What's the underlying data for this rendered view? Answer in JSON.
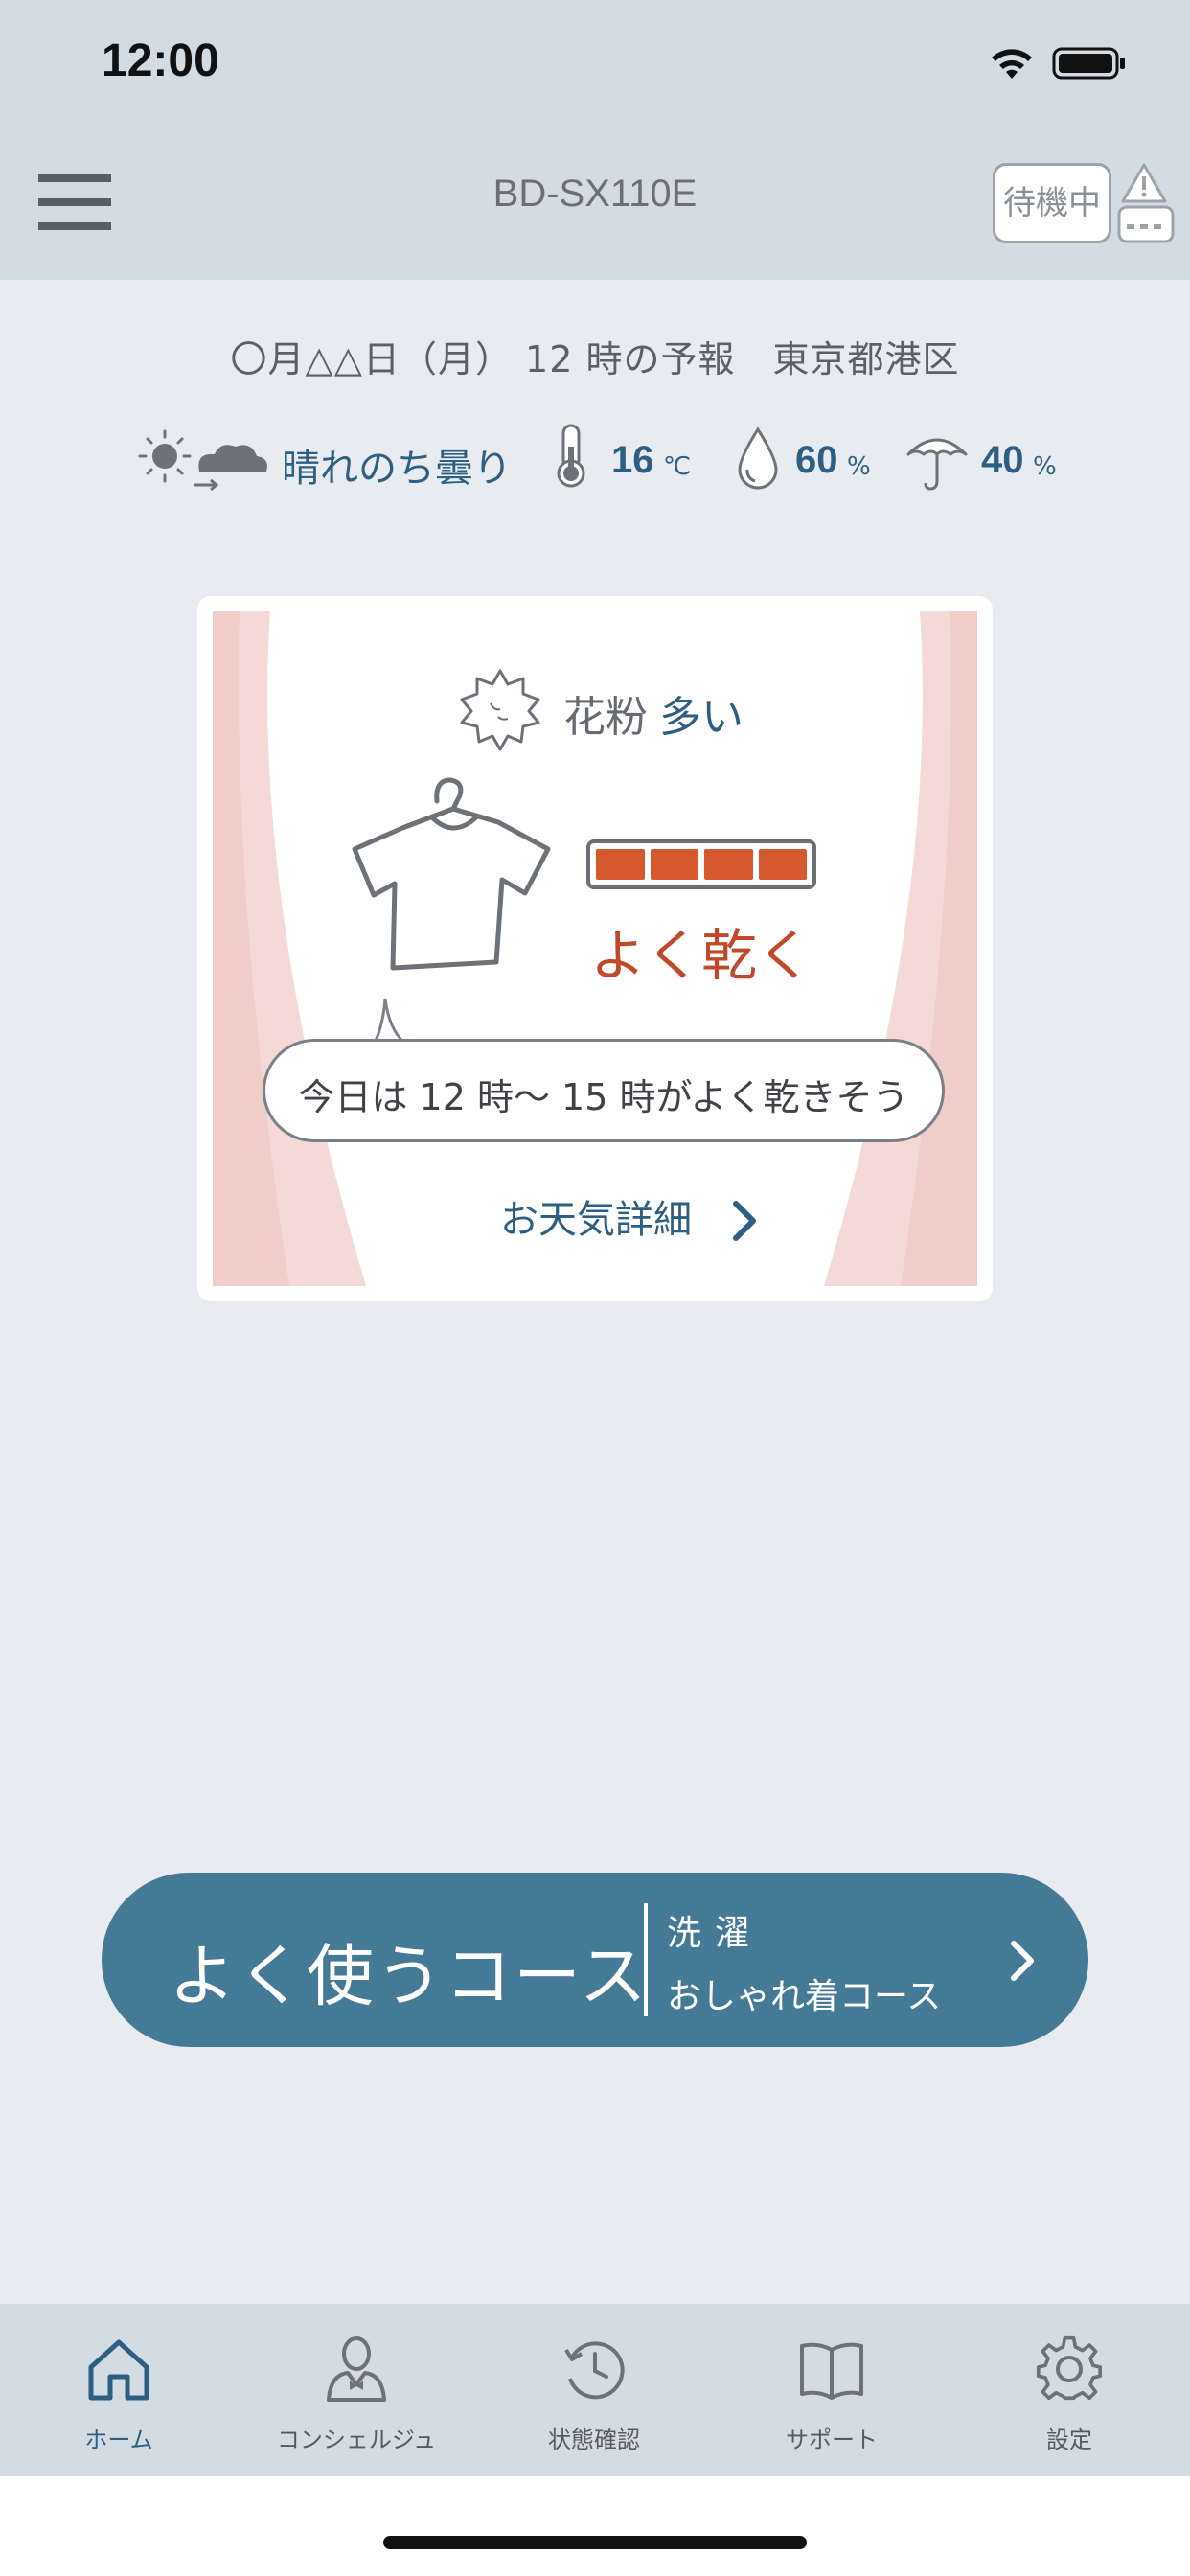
{
  "status_bar": {
    "time": "12:00"
  },
  "header": {
    "device_name": "BD-SX110E",
    "status_badge": "待機中"
  },
  "forecast": {
    "heading": "〇月△△日（月） 12 時の予報　東京都港区",
    "weather": "晴れのち曇り",
    "temperature": "16",
    "temperature_unit": "℃",
    "humidity": "60",
    "humidity_unit": "%",
    "rain_chance": "40",
    "rain_unit": "%"
  },
  "card": {
    "pollen_label": "花粉",
    "pollen_level": "多い",
    "dry_level_segments": 4,
    "dry_label": "よく乾く",
    "advice": "今日は 12 時〜 15 時がよく乾きそう",
    "detail_link": "お天気詳細"
  },
  "favorite_course": {
    "title": "よく使うコース",
    "type": "洗濯",
    "name": "おしゃれ着コース"
  },
  "tabs": [
    {
      "label": "ホーム",
      "icon": "home-icon",
      "active": true
    },
    {
      "label": "コンシェルジュ",
      "icon": "concierge-icon",
      "active": false
    },
    {
      "label": "状態確認",
      "icon": "clock-icon",
      "active": false
    },
    {
      "label": "サポート",
      "icon": "book-icon",
      "active": false
    },
    {
      "label": "設定",
      "icon": "gear-icon",
      "active": false
    }
  ],
  "colors": {
    "accent": "#2d5f82",
    "button": "#447a96",
    "dry_meter": "#d6582f",
    "header_bg": "#d3dbe3"
  }
}
